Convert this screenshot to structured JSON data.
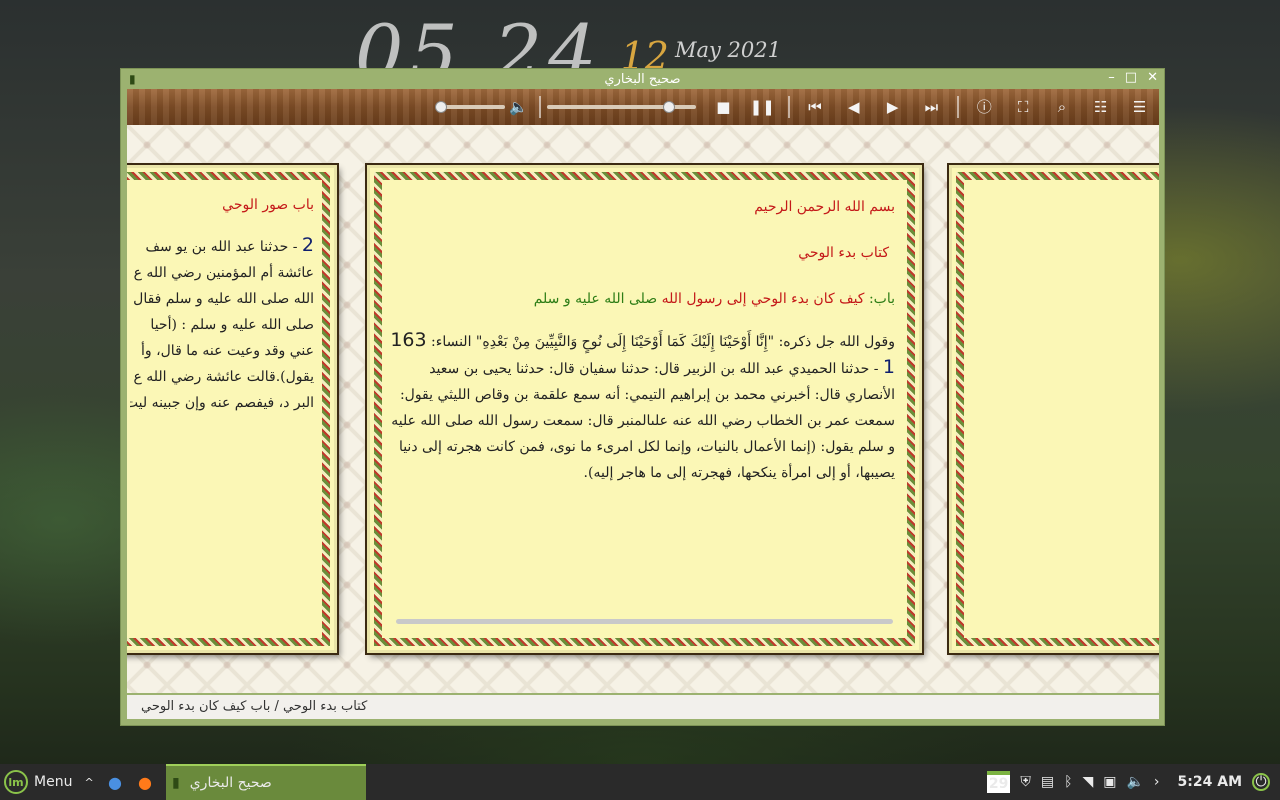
{
  "desktop_clock": {
    "hour_min": "05 24",
    "day": "12",
    "month_year": "May 2021"
  },
  "window": {
    "title": "صحيح البخاري",
    "controls": {
      "minimize": "–",
      "maximize": "□",
      "close": "✕"
    }
  },
  "toolbar": {
    "volume_level": 0.0,
    "progress_level": 0.8,
    "icons": [
      "volume-icon",
      "stop-icon",
      "pause-icon",
      "first-icon",
      "previous-icon",
      "next-icon",
      "last-icon",
      "info-icon",
      "fullscreen-icon",
      "search-icon",
      "index-icon",
      "menu-icon"
    ]
  },
  "pages": {
    "left": {
      "chapter": "باب صور الوحي",
      "hadith_number": "2",
      "lines": [
        "- حدثنا عبد الله بن يو سف",
        "عائشة أم المؤمنين رضي الله ع",
        "الله صلى الله عليه و سلم فقال",
        "صلى الله عليه و سلم : (أحيا",
        "عني وقد وعيت عنه ما قال، وأ",
        "يقول).قالت عائشة رضي الله ع",
        "البر د، فيفصم عنه وإن جبينه ليت"
      ]
    },
    "middle": {
      "basmala": "بسم الله الرحمن الرحيم",
      "book": "كتاب بدء الوحي",
      "bab_label": "باب:",
      "bab_title": "كيف كان بدء الوحي إلى رسول الله",
      "bab_salutation": "صلى الله عليه و سلم",
      "quran_intro": "وقول الله جل ذكره:",
      "quran_text": "\"إِنَّا أَوْحَيْنَا إِلَيْكَ كَمَا أَوْحَيْنَا إِلَى نُوحٍ وَالنَّبِيِّينَ مِنْ بَعْدِهِ\"",
      "quran_ref": "النساء:",
      "quran_ref_num": "163",
      "hadith_number": "1",
      "hadith_lines": [
        "- حدثنا الحميدي عبد الله بن الزبير قال: حدثنا سفيان قال: حدثنا يحيى بن",
        "سعيد الأنصاري قال: أخبرني محمد بن إبراهيم التيمي: أنه سمع علقمة بن وقاص",
        "الليثي يقول: سمعت عمر بن الخطاب رضي الله عنه علىالمنبر قال: سمعت رسول",
        "الله صلى الله عليه و سلم يقول: (إنما الأعمال بالنيات، وإنما لكل امرىء ما نوى، فمن",
        "كانت هجرته إلى دنيا يصيبها، أو إلى امرأة ينكحها، فهجرته إلى ما هاجر إليه)."
      ]
    }
  },
  "statusbar": {
    "breadcrumb": "كتاب بدء الوحي / باب كيف كان بدء الوحي"
  },
  "taskbar": {
    "menu_label": "Menu",
    "task_title": "صحيح البخاري",
    "calendar_day": "29",
    "time": "5:24 AM"
  }
}
